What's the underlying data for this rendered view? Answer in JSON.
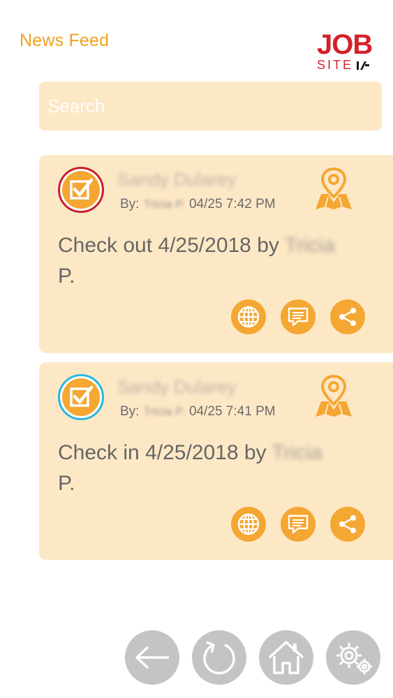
{
  "header": {
    "title": "News Feed",
    "logo_top": "JOB",
    "logo_bottom": "SITE"
  },
  "search": {
    "placeholder": "Search"
  },
  "feed": [
    {
      "status": "check-out",
      "name": "Sandy Dularey",
      "by_label": "By:",
      "author": "Tricia P.",
      "timestamp": "04/25 7:42 PM",
      "message": "Check out 4/25/2018 by",
      "message_who": "Tricia",
      "message_end": "P."
    },
    {
      "status": "check-in",
      "name": "Sandy Dularey",
      "by_label": "By:",
      "author": "Tricia P.",
      "timestamp": "04/25 7:41 PM",
      "message": "Check in 4/25/2018 by",
      "message_who": "Tricia",
      "message_end": "P."
    }
  ],
  "icons": {
    "status": "checkbox-icon",
    "map": "map-pin-icon",
    "globe": "globe-icon",
    "comment": "comment-icon",
    "share": "share-icon",
    "back": "back-arrow-icon",
    "refresh": "refresh-icon",
    "home": "home-icon",
    "settings": "gears-icon"
  },
  "colors": {
    "accent": "#f4a733",
    "card_bg": "#fde8c6",
    "title": "#f0a01e",
    "brand_red": "#d4202a",
    "checkout_ring": "#c8202c",
    "checkin_ring": "#29b8e0",
    "nav_button": "#c4c4c4"
  }
}
